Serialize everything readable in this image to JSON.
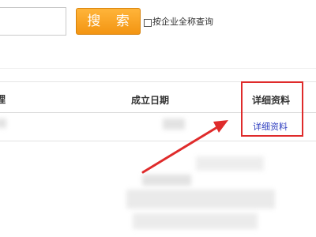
{
  "search": {
    "input_value": "",
    "button_label": "搜 索",
    "checkbox_label": "按企业全称查询",
    "checkbox_checked": false
  },
  "table": {
    "columns": [
      "理",
      "成立日期",
      "详细资料"
    ],
    "rows": [
      {
        "detail_link": "详细资料"
      }
    ]
  },
  "colors": {
    "search_button": "#f7a21f",
    "highlight": "#df2b2b",
    "link": "#2d3dbf"
  },
  "annotations": {
    "icon": "arrow-pointer-icon"
  }
}
